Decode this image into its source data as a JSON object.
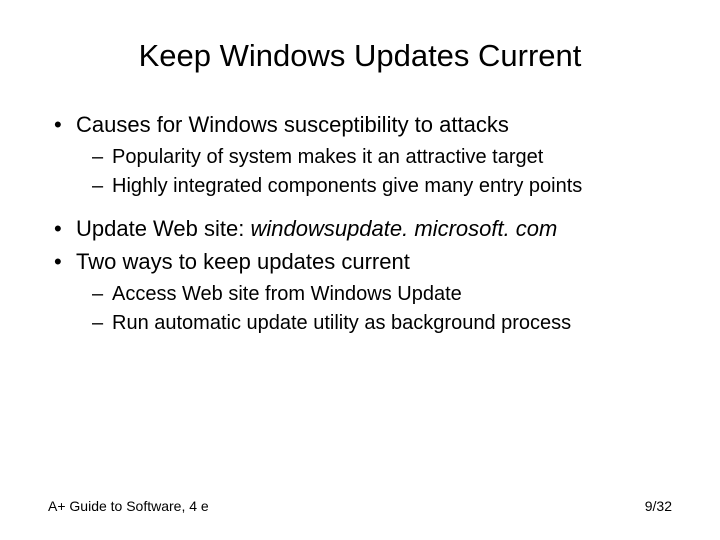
{
  "title": "Keep Windows Updates Current",
  "bullets": {
    "b1": {
      "text": "Causes for Windows susceptibility to attacks",
      "sub1": "Popularity of system makes it an attractive target",
      "sub2": "Highly integrated components give many entry points"
    },
    "b2": {
      "prefix": "Update Web site: ",
      "url": "windowsupdate. microsoft. com"
    },
    "b3": {
      "text": "Two ways to keep updates current",
      "sub1": "Access Web site from Windows Update",
      "sub2": "Run automatic update utility as background process"
    }
  },
  "footer": {
    "left": "A+ Guide to Software, 4 e",
    "right": "9/32"
  }
}
